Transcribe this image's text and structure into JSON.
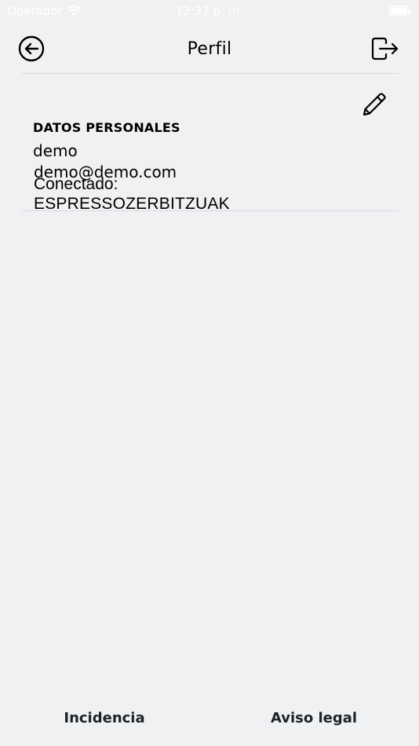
{
  "status_bar": {
    "carrier": "Operador",
    "time": "12:27 p. m."
  },
  "header": {
    "title": "Perfil",
    "back_icon": "arrow-left-circle-icon",
    "logout_icon": "logout-icon"
  },
  "profile": {
    "edit_icon": "pencil-icon",
    "section_heading": "DATOS PERSONALES",
    "name": "demo",
    "email": "demo@demo.com",
    "connected_label": "Conectado:",
    "connected_value": "ESPRESSOZERBITZUAK"
  },
  "footer": {
    "left_label": "Incidencia",
    "right_label": "Aviso legal"
  },
  "colors": {
    "background": "#f0f1f3",
    "text": "#000000",
    "footer_text": "#1f2329",
    "divider": "#d8d9dc"
  }
}
